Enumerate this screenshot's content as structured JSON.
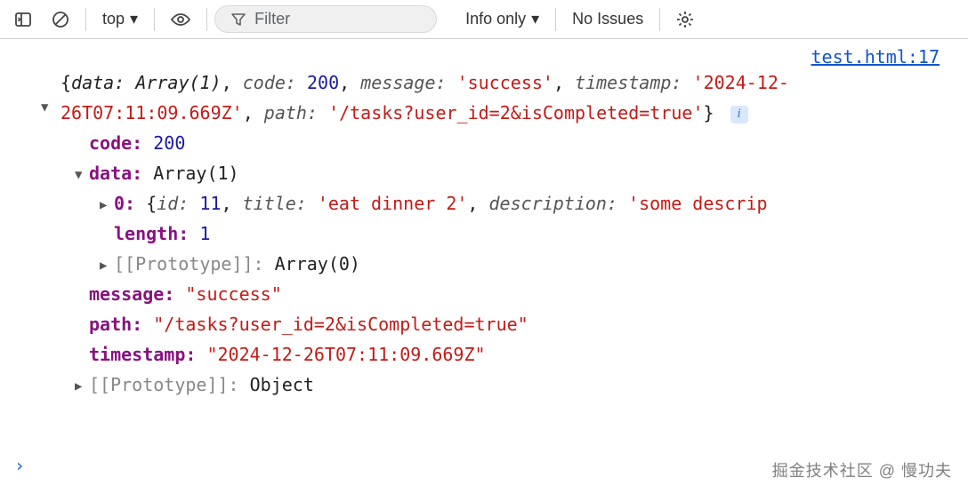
{
  "toolbar": {
    "context": "top",
    "filter_placeholder": "Filter",
    "level": "Info only",
    "issues": "No Issues"
  },
  "source": {
    "file": "test.html",
    "line": "17"
  },
  "summary": {
    "open_brace": "{",
    "data_key": "data:",
    "data_val": "Array(1)",
    "code_key": "code:",
    "code_val": "200",
    "message_key": "message:",
    "message_val": "'success'",
    "timestamp_key": "timestamp:",
    "timestamp_val": "'2024-12-26T07:11:09.669Z'",
    "path_key": "path:",
    "path_val": "'/tasks?user_id=2&isCompleted=true'",
    "close_brace": "}"
  },
  "expanded": {
    "code": {
      "k": "code",
      "v": "200"
    },
    "data": {
      "k": "data",
      "v": "Array(1)"
    },
    "item0": {
      "k": "0",
      "preview_open": "{",
      "id_k": "id:",
      "id_v": "11",
      "title_k": "title:",
      "title_v": "'eat dinner 2'",
      "desc_k": "description:",
      "desc_v": "'some descrip"
    },
    "length": {
      "k": "length",
      "v": "1"
    },
    "proto_arr": {
      "k": "[[Prototype]]",
      "v": "Array(0)"
    },
    "message": {
      "k": "message",
      "v": "\"success\""
    },
    "path": {
      "k": "path",
      "v": "\"/tasks?user_id=2&isCompleted=true\""
    },
    "timestamp": {
      "k": "timestamp",
      "v": "\"2024-12-26T07:11:09.669Z\""
    },
    "proto_obj": {
      "k": "[[Prototype]]",
      "v": "Object"
    }
  },
  "watermark": "掘金技术社区 @ 慢功夫"
}
